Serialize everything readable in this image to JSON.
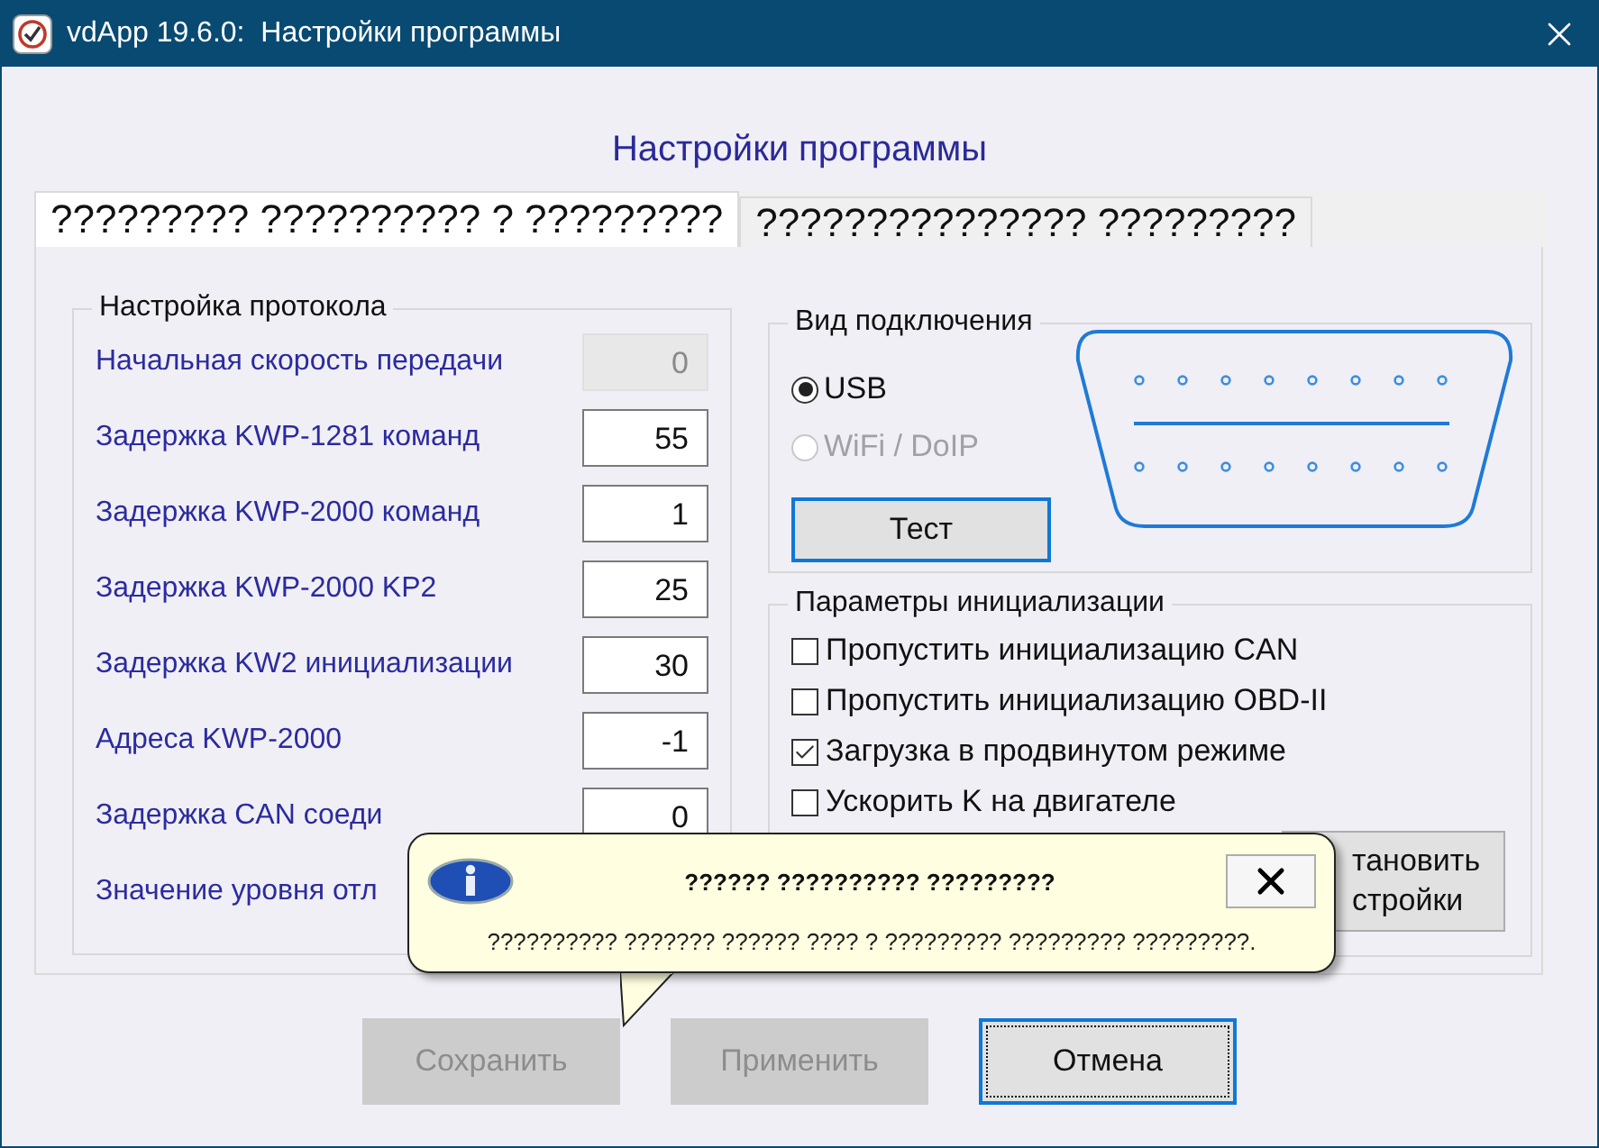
{
  "window": {
    "title": "vdApp 19.6.0:  Настройки программы"
  },
  "heading": "Настройки программы",
  "tabs": [
    {
      "label": "????????? ?????????? ? ?????????",
      "selected": true
    },
    {
      "label": "??????????????? ?????????",
      "selected": false
    }
  ],
  "protocol": {
    "title": "Настройка протокола",
    "rows": [
      {
        "label": "Начальная скорость передачи",
        "value": "0",
        "disabled": true
      },
      {
        "label": "Задержка KWP-1281 команд",
        "value": "55",
        "disabled": false
      },
      {
        "label": "Задержка KWP-2000 команд",
        "value": "1",
        "disabled": false
      },
      {
        "label": "Задержка KWP-2000 KP2",
        "value": "25",
        "disabled": false
      },
      {
        "label": "Задержка KW2 инициализации",
        "value": "30",
        "disabled": false
      },
      {
        "label": "Адреса KWP-2000",
        "value": "-1",
        "disabled": false
      },
      {
        "label": "Задержка CAN соеди",
        "value": "0",
        "disabled": false
      },
      {
        "label": "Значение уровня отл"
      }
    ]
  },
  "connection": {
    "title": "Вид подключения",
    "radios": [
      {
        "label": "USB",
        "selected": true,
        "disabled": false
      },
      {
        "label": "WiFi / DoIP",
        "selected": false,
        "disabled": true
      }
    ],
    "test_button": "Тест"
  },
  "init": {
    "title": "Параметры инициализации",
    "checkboxes": [
      {
        "label": "Пропустить инициализацию CAN",
        "checked": false
      },
      {
        "label": "Пропустить инициализацию OBD-II",
        "checked": false
      },
      {
        "label": "Загрузка в продвинутом режиме",
        "checked": true
      },
      {
        "label": "Ускорить K на двигателе",
        "checked": false
      }
    ],
    "button_lines": [
      "тановить",
      "стройки"
    ]
  },
  "buttons": [
    {
      "label": "Сохранить",
      "disabled": true,
      "focused": false
    },
    {
      "label": "Применить",
      "disabled": true,
      "focused": false
    },
    {
      "label": "Отмена",
      "disabled": false,
      "focused": true
    }
  ],
  "balloon": {
    "title": "?????? ?????????? ?????????",
    "message": "?????????? ??????? ?????? ???? ? ????????? ????????? ?????????."
  }
}
